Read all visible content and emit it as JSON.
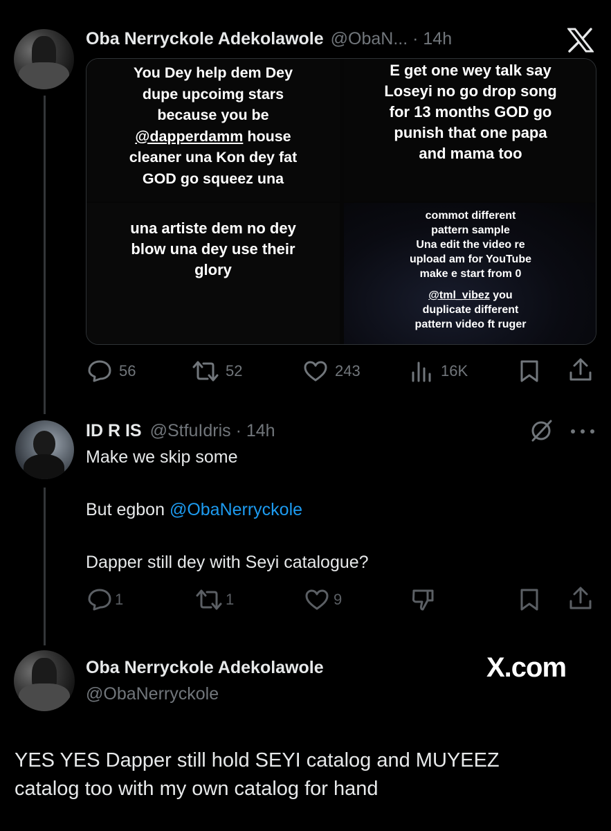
{
  "tweet1": {
    "author_name": "Oba Nerryckole Adekolawole",
    "handle_time": "@ObaN... · 14h",
    "images": {
      "top_left": [
        "You Dey help dem Dey",
        "dupe upcoimg stars",
        "because you be",
        "@dapperdamm",
        " house",
        "cleaner una Kon dey fat",
        "GOD go squeez una"
      ],
      "top_right": [
        "E get one wey talk say",
        "Loseyi no go drop song",
        "for 13 months GOD go",
        "punish that one papa",
        "and mama too"
      ],
      "bottom_left": [
        "una artiste dem no dey",
        "blow una dey use their",
        "glory"
      ],
      "bottom_right": [
        "commot different",
        "pattern sample",
        "Una edit the video re",
        "upload am for YouTube",
        "make e start from 0",
        "@tml_vibez",
        " you",
        "duplicate different",
        "pattern video ft ruger"
      ]
    },
    "stats": {
      "replies": "56",
      "reposts": "52",
      "likes": "243",
      "views": "16K"
    }
  },
  "tweet2": {
    "author_name": "ID R IS",
    "handle_time": "@StfuIdris · 14h",
    "text_line1": "Make we skip some",
    "text_line2_prefix": "But egbon ",
    "text_line2_mention": "@ObaNerryckole",
    "text_line3": "Dapper still dey with Seyi catalogue?",
    "stats": {
      "replies": "1",
      "reposts": "1",
      "likes": "9"
    }
  },
  "tweet3": {
    "author_name": "Oba Nerryckole Adekolawole",
    "handle": "@ObaNerryckole",
    "watermark": "X.com",
    "text_line1": "YES YES Dapper still hold SEYI catalog and MUYEEZ",
    "text_line2": "catalog too with my own catalog for hand"
  },
  "icons": [
    "x-logo-icon",
    "reply-icon",
    "repost-icon",
    "like-icon",
    "views-icon",
    "bookmark-icon",
    "share-icon",
    "grok-icon",
    "more-icon",
    "dislike-icon"
  ],
  "colors": {
    "background": "#000000",
    "text": "#e7e9ea",
    "secondary": "#71767b",
    "link": "#1d9bf0",
    "divider": "#333639"
  }
}
